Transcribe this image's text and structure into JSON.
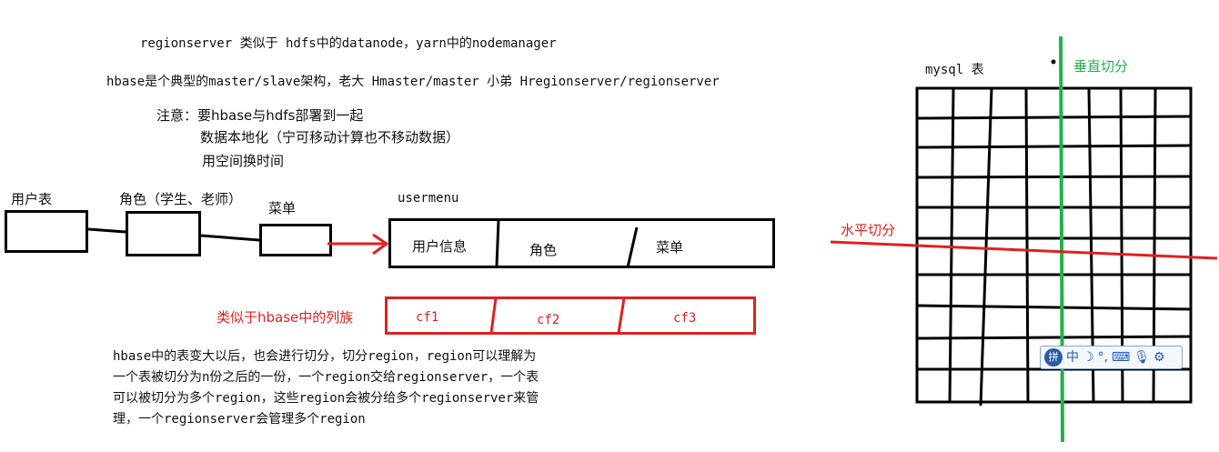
{
  "notes": {
    "line1": "regionserver 类似于 hdfs中的datanode，yarn中的nodemanager",
    "line2": "hbase是个典型的master/slave架构，老大 Hmaster/master 小弟 Hregionserver/regionserver",
    "line3": "注意：要hbase与hdfs部署到一起",
    "line4": "数据本地化（宁可移动计算也不移动数据）",
    "line5": "用空间换时间"
  },
  "entities": {
    "user_table": "用户表",
    "role": "角色（学生、老师）",
    "menu": "菜单"
  },
  "usermenu": {
    "title": "usermenu",
    "cells": [
      "用户信息",
      "角色",
      "菜单"
    ]
  },
  "column_family": {
    "label": "类似于hbase中的列族",
    "cells": [
      "cf1",
      "cf2",
      "cf3"
    ]
  },
  "region_note": {
    "line1": "hbase中的表变大以后，也会进行切分，切分region，region可以理解为",
    "line2": "一个表被切分为n份之后的一份，一个region交给regionserver，一个表",
    "line3": "可以被切分为多个region，这些region会被分给多个regionserver来管",
    "line4": "理，一个regionserver会管理多个region"
  },
  "mysql": {
    "title": "mysql 表",
    "vertical_split": "垂直切分",
    "horizontal_split": "水平切分"
  },
  "ime_toolbar": {
    "logo": "拼",
    "mode": "中",
    "icons": [
      "moon-icon",
      "punctuation-icon",
      "keyboard-icon",
      "mic-icon",
      "gear-icon"
    ]
  },
  "colors": {
    "red": "#e02020",
    "green": "#22b14c",
    "black": "#000000"
  }
}
